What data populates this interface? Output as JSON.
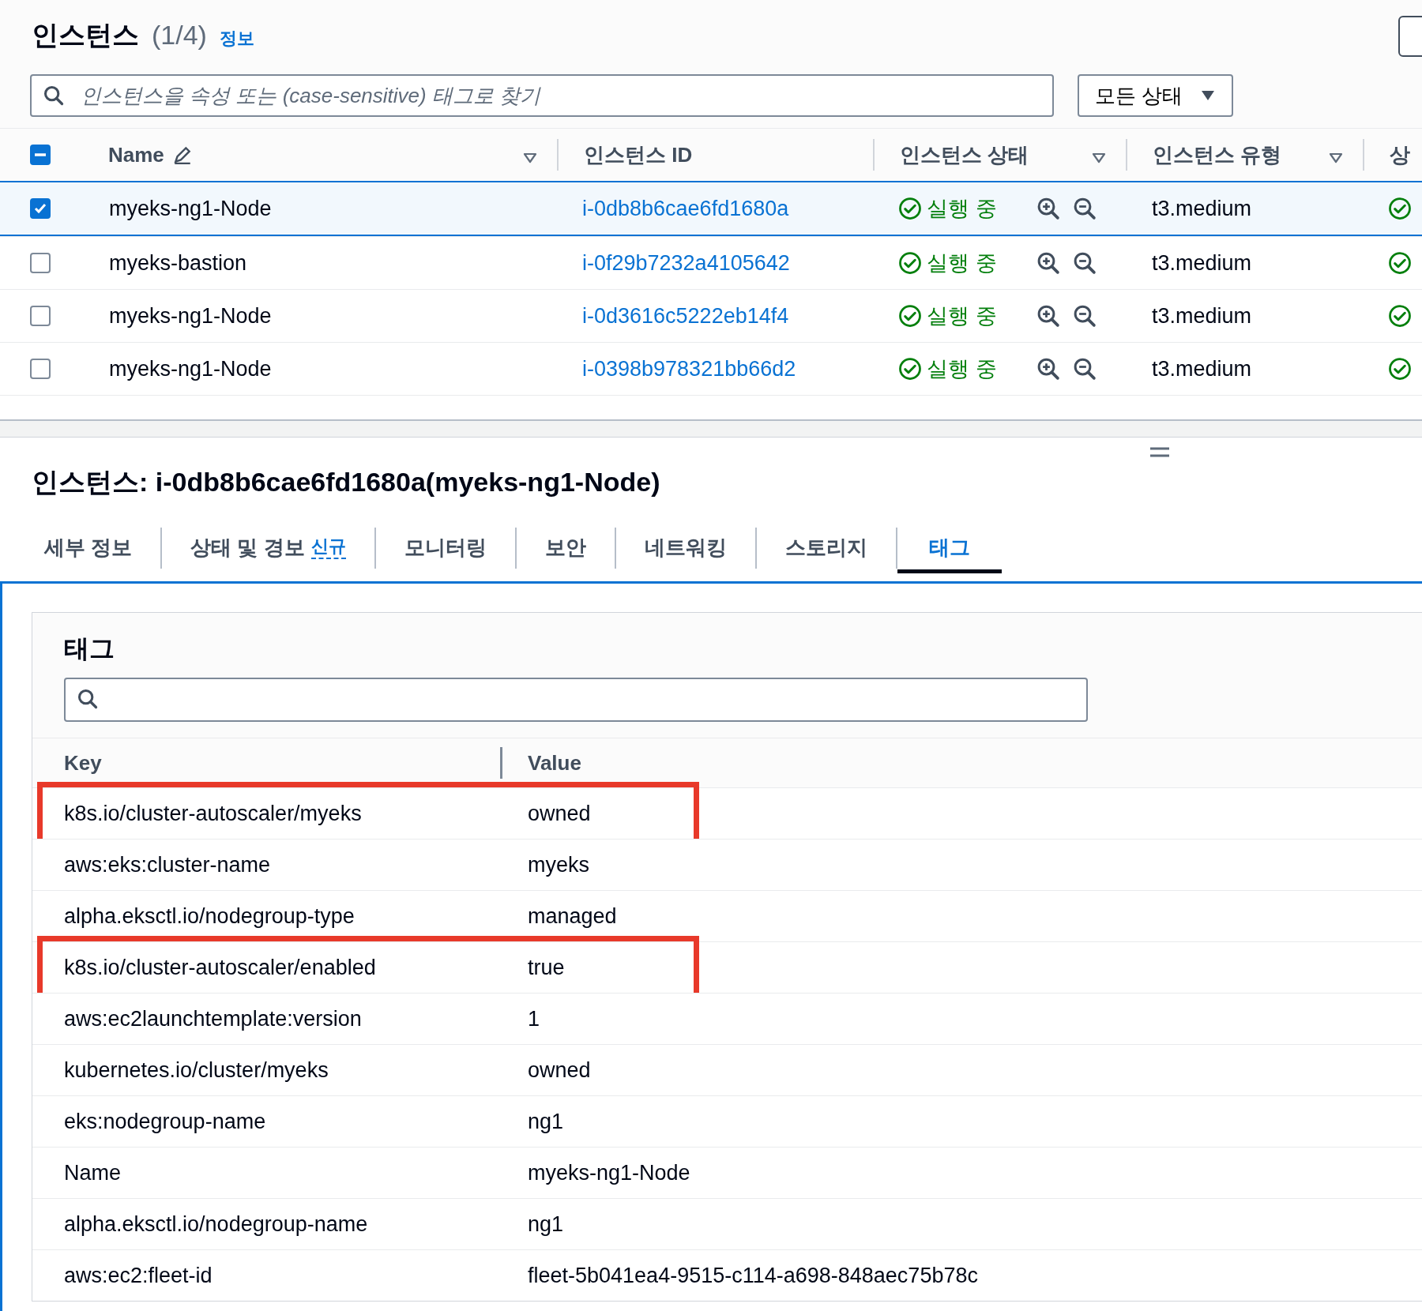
{
  "header": {
    "title": "인스턴스",
    "count": "(1/4)",
    "info_link": "정보"
  },
  "search": {
    "placeholder": "인스턴스을 속성 또는 (case-sensitive) 태그로 찾기"
  },
  "state_filter": {
    "value": "모든 상태"
  },
  "instances": {
    "all_checkbox": {
      "indeterminate": true
    },
    "columns": [
      {
        "label": "Name",
        "editable": true,
        "filter": true
      },
      {
        "label": "인스턴스 ID",
        "filter": false
      },
      {
        "label": "인스턴스 상태",
        "filter": true
      },
      {
        "label": "인스턴스 유형",
        "filter": true
      },
      {
        "label": "상",
        "filter": false
      }
    ],
    "rows": [
      {
        "selected": true,
        "name": "myeks-ng1-Node",
        "instance_id": "i-0db8b6cae6fd1680a",
        "state": "실행 중",
        "type": "t3.medium"
      },
      {
        "selected": false,
        "name": "myeks-bastion",
        "instance_id": "i-0f29b7232a4105642",
        "state": "실행 중",
        "type": "t3.medium"
      },
      {
        "selected": false,
        "name": "myeks-ng1-Node",
        "instance_id": "i-0d3616c5222eb14f4",
        "state": "실행 중",
        "type": "t3.medium"
      },
      {
        "selected": false,
        "name": "myeks-ng1-Node",
        "instance_id": "i-0398b978321bb66d2",
        "state": "실행 중",
        "type": "t3.medium"
      }
    ]
  },
  "details": {
    "title": "인스턴스: i-0db8b6cae6fd1680a(myeks-ng1-Node)",
    "tabs": [
      {
        "label": "세부 정보",
        "selected": false
      },
      {
        "label": "상태 및 경보",
        "badge": "신규",
        "selected": false
      },
      {
        "label": "모니터링",
        "selected": false
      },
      {
        "label": "보안",
        "selected": false
      },
      {
        "label": "네트워킹",
        "selected": false
      },
      {
        "label": "스토리지",
        "selected": false
      },
      {
        "label": "태그",
        "selected": true
      }
    ]
  },
  "tags": {
    "title": "태그",
    "columns": [
      "Key",
      "Value"
    ],
    "rows": [
      {
        "key": "k8s.io/cluster-autoscaler/myeks",
        "value": "owned",
        "highlighted": true
      },
      {
        "key": "aws:eks:cluster-name",
        "value": "myeks",
        "highlighted": false
      },
      {
        "key": "alpha.eksctl.io/nodegroup-type",
        "value": "managed",
        "highlighted": false
      },
      {
        "key": "k8s.io/cluster-autoscaler/enabled",
        "value": "true",
        "highlighted": true
      },
      {
        "key": "aws:ec2launchtemplate:version",
        "value": "1",
        "highlighted": false
      },
      {
        "key": "kubernetes.io/cluster/myeks",
        "value": "owned",
        "highlighted": false
      },
      {
        "key": "eks:nodegroup-name",
        "value": "ng1",
        "highlighted": false
      },
      {
        "key": "Name",
        "value": "myeks-ng1-Node",
        "highlighted": false
      },
      {
        "key": "alpha.eksctl.io/nodegroup-name",
        "value": "ng1",
        "highlighted": false
      },
      {
        "key": "aws:ec2:fleet-id",
        "value": "fleet-5b041ea4-9515-c114-a698-848aec75b78c",
        "highlighted": false
      }
    ]
  }
}
